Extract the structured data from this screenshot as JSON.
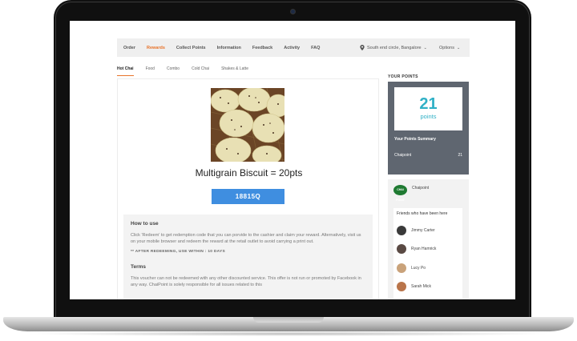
{
  "nav": {
    "items": [
      {
        "label": "Order",
        "active": false
      },
      {
        "label": "Rewards",
        "active": true
      },
      {
        "label": "Collect Points",
        "active": false
      },
      {
        "label": "Information",
        "active": false
      },
      {
        "label": "Feedback",
        "active": false
      },
      {
        "label": "Activity",
        "active": false
      },
      {
        "label": "FAQ",
        "active": false
      }
    ],
    "location": "South end circle, Bangalore",
    "options_label": "Options",
    "accent_color": "#e8732a"
  },
  "tabs": [
    {
      "label": "Hot Chai",
      "active": true
    },
    {
      "label": "Food",
      "active": false
    },
    {
      "label": "Combo",
      "active": false
    },
    {
      "label": "Cold Chai",
      "active": false
    },
    {
      "label": "Shakes & Latte",
      "active": false
    }
  ],
  "reward": {
    "title": "Multigrain Biscuit = 20pts",
    "code": "18815Q",
    "how_to_use_title": "How to use",
    "how_to_use_text": "Click 'Redeem' to get redemption code that you can porvide to the cashier and claim your reward. Alternatively, visit us on your mobile browser and redeem the reward at the retail outlet to avoid carrying a print out.",
    "after_note": "** AFTER REDEEMING, USE WITHIN : 10 DAYS",
    "terms_title": "Terms",
    "terms_text": "This voucher can not be redeemed with any other discounted service. This offer is not run or promoted by Facebook in any way. ChaiPoint is solely responsible for all issues related to this"
  },
  "points": {
    "heading": "YOUR POINTS",
    "value": "21",
    "unit": "points",
    "summary_title": "Your Points Summary",
    "summary_rows": [
      {
        "name": "Chaipoint",
        "value": "21"
      }
    ],
    "accent_color": "#2fb0c6"
  },
  "chaipoint": {
    "logo_text": "CHAI POINT",
    "name": "Chaipoint",
    "friends_title": "Friends who have been here",
    "friends": [
      {
        "name": "Jimmy Carter",
        "avatar_color": "#3a3a3a"
      },
      {
        "name": "Ryan Hamrick",
        "avatar_color": "#5a4a44"
      },
      {
        "name": "Lucy Po",
        "avatar_color": "#c9a27a"
      },
      {
        "name": "Sarah Mick",
        "avatar_color": "#b9744a"
      }
    ]
  }
}
